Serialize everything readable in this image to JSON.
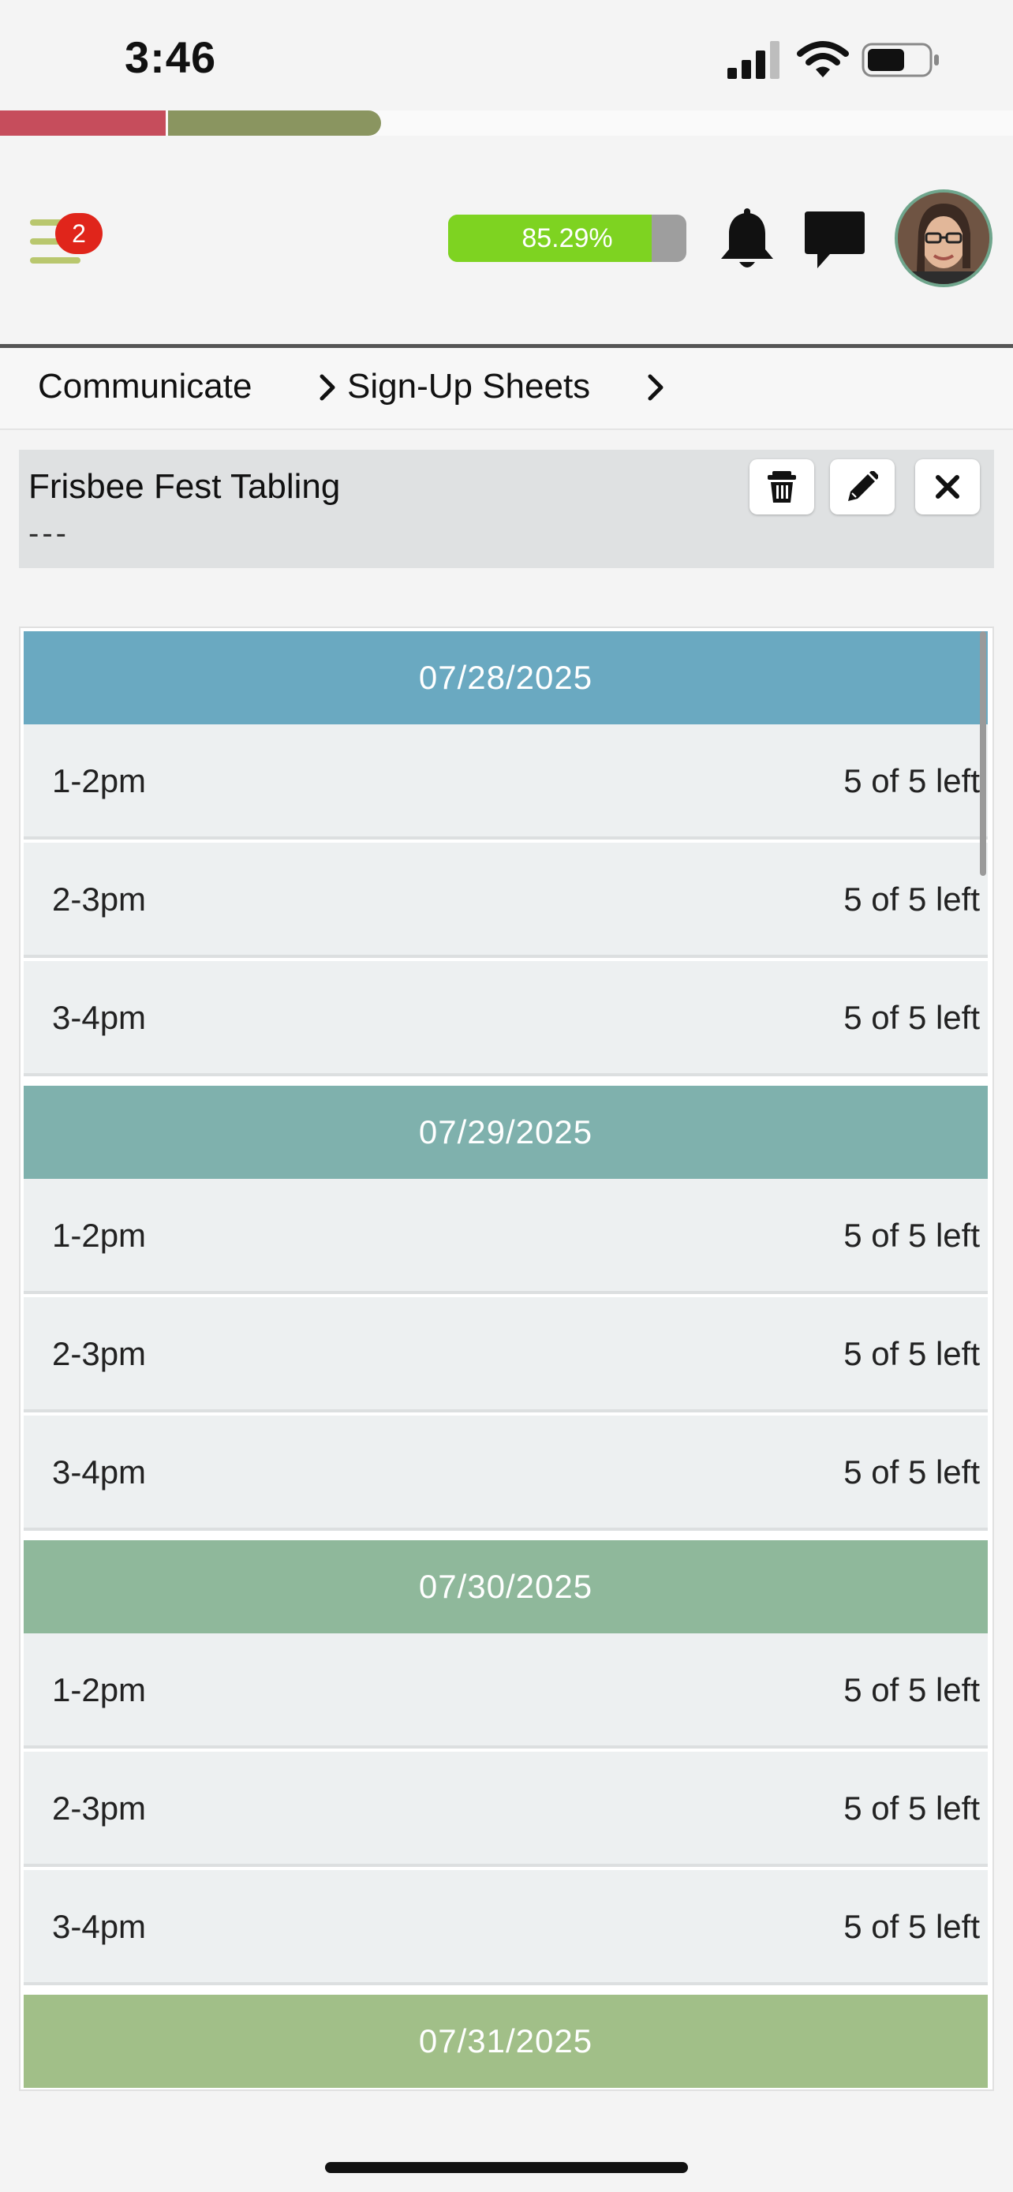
{
  "status_bar": {
    "time": "3:46"
  },
  "progress_strip": {
    "red_fraction": 0.163,
    "green_fraction": 0.21
  },
  "header": {
    "menu_badge_count": "2",
    "score_text": "85.29%",
    "score_value": 85.29
  },
  "breadcrumb": {
    "items": [
      {
        "label": "Communicate"
      },
      {
        "label": "Sign-Up Sheets"
      }
    ]
  },
  "sheet": {
    "title": "Frisbee Fest Tabling",
    "subtitle": "---"
  },
  "toolbar": {
    "delete_icon": "trash-icon",
    "edit_icon": "pencil-icon",
    "close_icon": "close-icon"
  },
  "colors": {
    "date_1": "#6aa9c1",
    "date_2": "#7fb1ad",
    "date_3": "#8fb89b",
    "date_4": "#a1bf88",
    "accent_green": "#7ed321",
    "badge_red": "#e0251b"
  },
  "days": [
    {
      "date": "07/28/2025",
      "slots": [
        {
          "time": "1-2pm",
          "avail": "5 of 5 left"
        },
        {
          "time": "2-3pm",
          "avail": "5 of 5 left"
        },
        {
          "time": "3-4pm",
          "avail": "5 of 5 left"
        }
      ]
    },
    {
      "date": "07/29/2025",
      "slots": [
        {
          "time": "1-2pm",
          "avail": "5 of 5 left"
        },
        {
          "time": "2-3pm",
          "avail": "5 of 5 left"
        },
        {
          "time": "3-4pm",
          "avail": "5 of 5 left"
        }
      ]
    },
    {
      "date": "07/30/2025",
      "slots": [
        {
          "time": "1-2pm",
          "avail": "5 of 5 left"
        },
        {
          "time": "2-3pm",
          "avail": "5 of 5 left"
        },
        {
          "time": "3-4pm",
          "avail": "5 of 5 left"
        }
      ]
    },
    {
      "date": "07/31/2025",
      "slots": []
    }
  ]
}
